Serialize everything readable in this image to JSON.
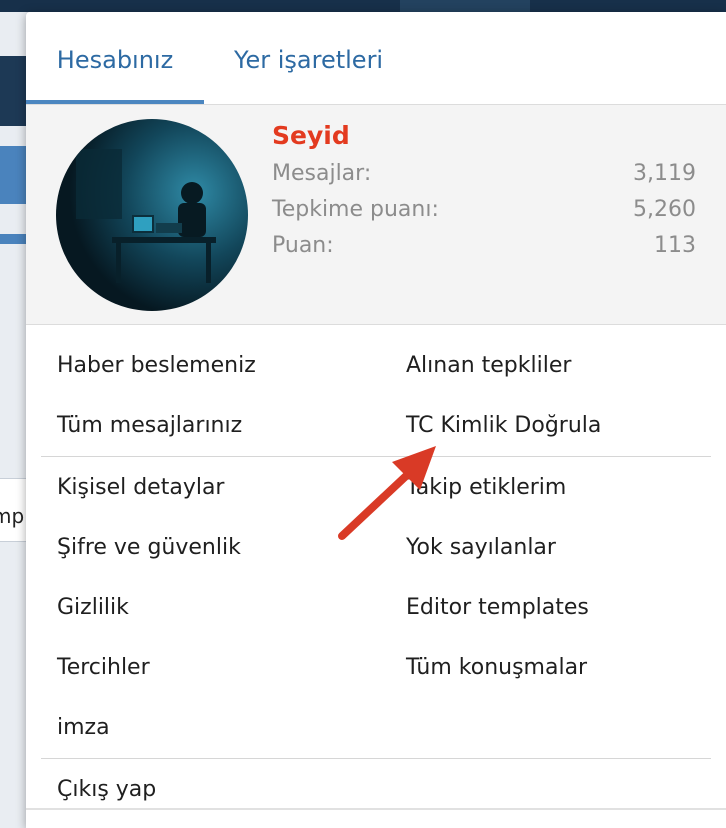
{
  "tabs": [
    {
      "label": "Hesabınız"
    },
    {
      "label": "Yer işaretleri"
    }
  ],
  "background": {
    "cut_text": "mp"
  },
  "profile": {
    "username": "Seyid",
    "stats": [
      {
        "label": "Mesajlar:",
        "value": "3,119"
      },
      {
        "label": "Tepkime puanı:",
        "value": "5,260"
      },
      {
        "label": "Puan:",
        "value": "113"
      }
    ]
  },
  "menu": {
    "section1": {
      "left": [
        "Haber beslemeniz",
        "Tüm mesajlarınız"
      ],
      "right": [
        "Alınan tepkliler",
        "TC Kimlik Doğrula"
      ]
    },
    "section2": {
      "left": [
        "Kişisel detaylar",
        "Şifre ve güvenlik",
        "Gizlilik",
        "Tercihler",
        "imza"
      ],
      "right": [
        "Takip etiklerim",
        "Yok sayılanlar",
        "Editor templates",
        "Tüm konuşmalar"
      ]
    },
    "logout": "Çıkış yap"
  },
  "colors": {
    "accent": "#2d6aa3",
    "username": "#e33a1f",
    "annotation_arrow": "#d93a26"
  }
}
